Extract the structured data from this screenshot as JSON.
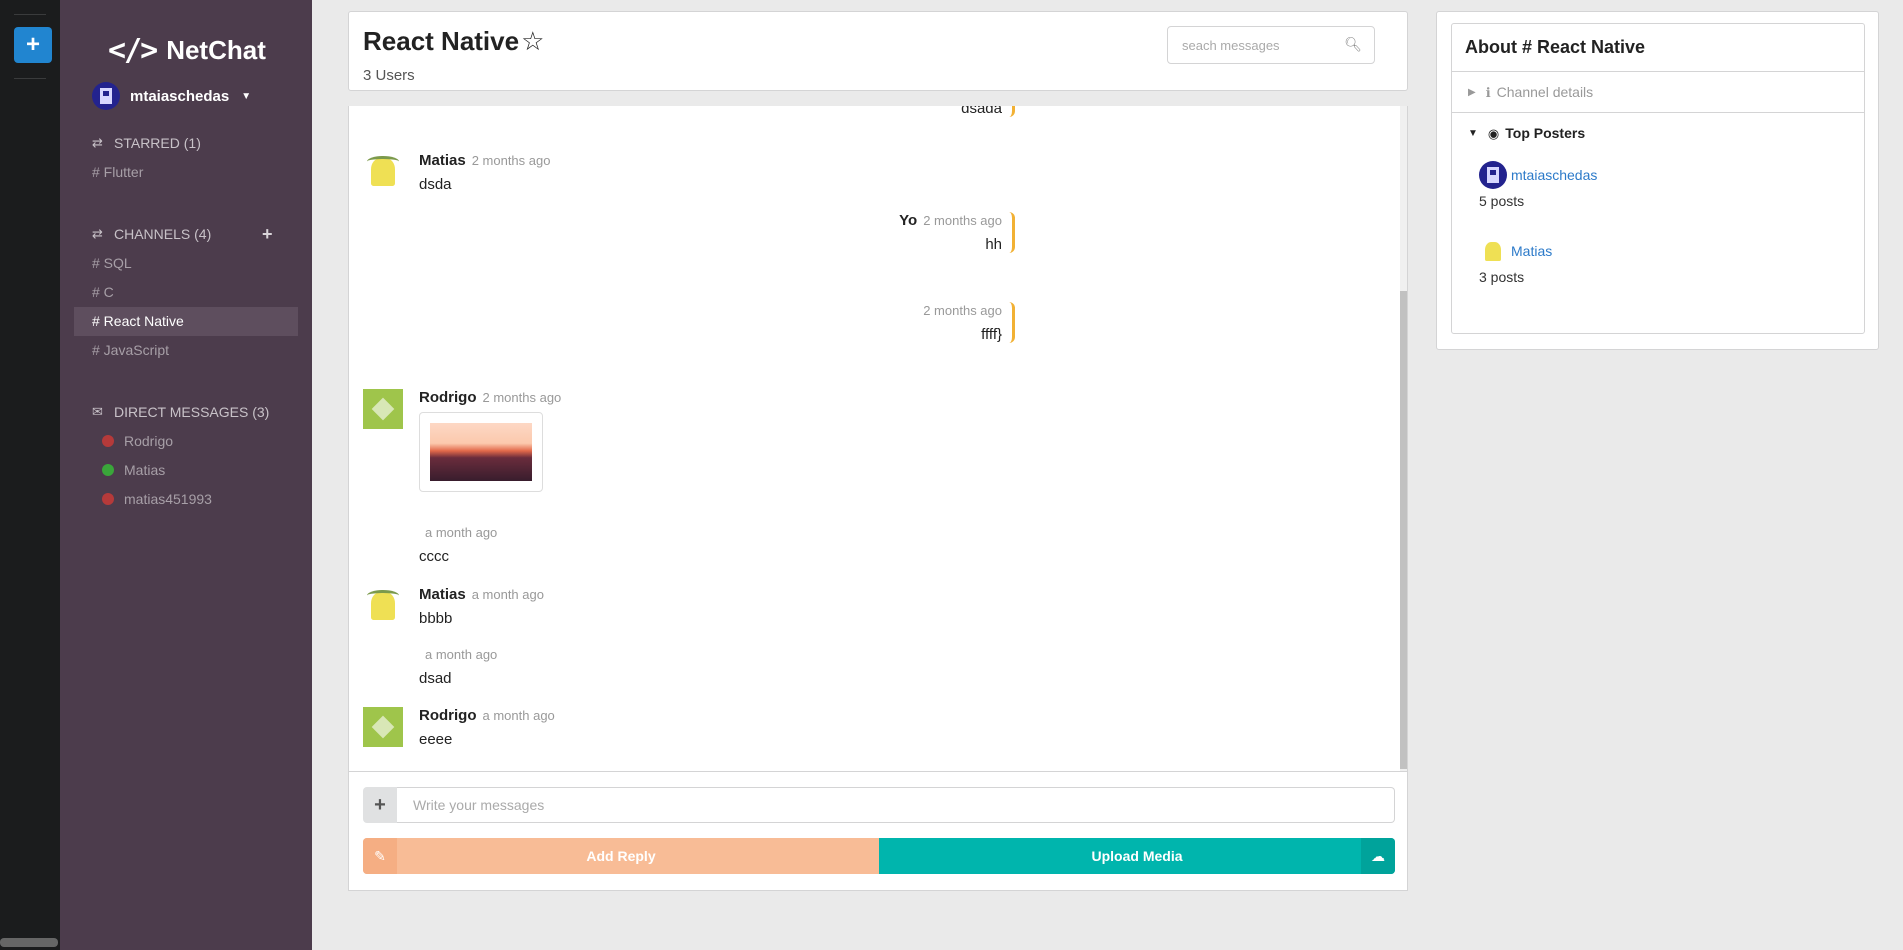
{
  "rail": {
    "add_label": "+"
  },
  "sidebar": {
    "app_name": "NetChat",
    "code_icon_glyph": "</>",
    "user_name": "mtaiaschedas",
    "starred": {
      "label": "STARRED (1)",
      "items": [
        "# Flutter"
      ]
    },
    "channels": {
      "label": "CHANNELS (4)",
      "add_label": "+",
      "items": [
        "# SQL",
        "# C",
        "# React Native",
        "# JavaScript"
      ],
      "active": "# React Native"
    },
    "direct_messages": {
      "label": "DIRECT MESSAGES (3)",
      "items": [
        {
          "name": "Rodrigo",
          "status": "offline"
        },
        {
          "name": "Matias",
          "status": "online"
        },
        {
          "name": "matias451993",
          "status": "offline"
        }
      ]
    }
  },
  "header": {
    "channel_title": "React Native",
    "star_glyph": "☆",
    "users_count": "3 Users",
    "search_placeholder": "seach messages"
  },
  "messages": [
    {
      "own": true,
      "text": "dsada"
    },
    {
      "author": "Matias",
      "time": "2 months ago",
      "text": "dsda"
    },
    {
      "own": true,
      "author": "Yo",
      "time": "2 months ago",
      "text": "hh"
    },
    {
      "own": true,
      "author": "",
      "time": "2 months ago",
      "text": "ffff}"
    },
    {
      "author": "Rodrigo",
      "time": "2 months ago",
      "image": true
    },
    {
      "author": "",
      "time": "a month ago",
      "text": "cccc"
    },
    {
      "author": "Matias",
      "time": "a month ago",
      "text": "bbbb"
    },
    {
      "author": "",
      "time": "a month ago",
      "text": "dsad"
    },
    {
      "author": "Rodrigo",
      "time": "a month ago",
      "text": "eeee"
    }
  ],
  "composer": {
    "plus_label": "+",
    "placeholder": "Write your messages",
    "reply_label": "Add Reply",
    "upload_label": "Upload Media"
  },
  "about": {
    "title": "About # React Native",
    "channel_details_label": "Channel details",
    "top_posters_label": "Top Posters",
    "posters": [
      {
        "name": "mtaiaschedas",
        "count": "5 posts"
      },
      {
        "name": "Matias",
        "count": "3 posts"
      }
    ]
  },
  "colors": {
    "rail_bg": "#1b1c1d",
    "sidebar_bg": "#4c3c4c",
    "primary_blue": "#2185d0",
    "own_message_accent": "#f2b134",
    "reply_orange": "#f8bc96",
    "upload_teal": "#00b5ad",
    "link_blue": "#2c7ac9"
  }
}
